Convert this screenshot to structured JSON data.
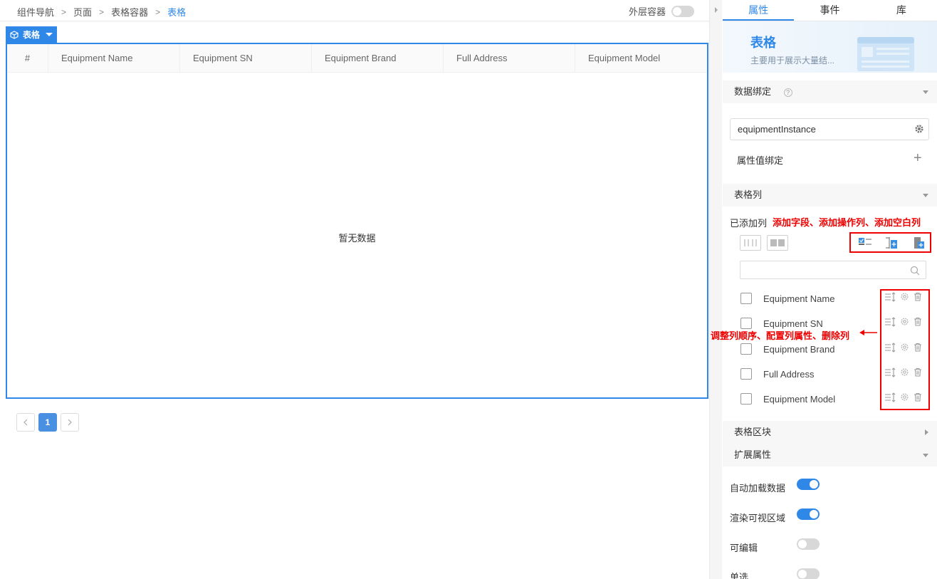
{
  "breadcrumb": {
    "items": [
      "组件导航",
      "页面",
      "表格容器"
    ],
    "current": "表格"
  },
  "outer_container": {
    "label": "外层容器",
    "enabled": false
  },
  "component_tag": {
    "label": "表格"
  },
  "table": {
    "index_header": "#",
    "columns": [
      "Equipment Name",
      "Equipment SN",
      "Equipment Brand",
      "Full Address",
      "Equipment Model"
    ],
    "empty_text": "暂无数据"
  },
  "pagination": {
    "current_page": "1"
  },
  "panel": {
    "tabs": [
      "属性",
      "事件",
      "库"
    ],
    "active_tab": "属性",
    "hero": {
      "title": "表格",
      "description": "主要用于展示大量结..."
    },
    "data_binding": {
      "header": "数据绑定",
      "help_icon": "?",
      "bound_value": "equipmentInstance",
      "attr_binding_label": "属性值绑定"
    },
    "table_columns": {
      "header": "表格列",
      "added_label": "已添加列",
      "annotation_top": "添加字段、添加操作列、添加空白列",
      "annotation_side": "调整列顺序、配置列属性、删除列",
      "search_placeholder": "",
      "items": [
        "Equipment Name",
        "Equipment SN",
        "Equipment Brand",
        "Full Address",
        "Equipment Model"
      ]
    },
    "table_block": {
      "header": "表格区块"
    },
    "extended": {
      "header": "扩展属性",
      "options": [
        {
          "label": "自动加载数据",
          "enabled": true
        },
        {
          "label": "渲染可视区域",
          "enabled": true
        },
        {
          "label": "可编辑",
          "enabled": false
        },
        {
          "label": "单选",
          "enabled": false
        }
      ]
    }
  },
  "colors": {
    "accent": "#2f88e8",
    "annotation": "#e00000"
  }
}
